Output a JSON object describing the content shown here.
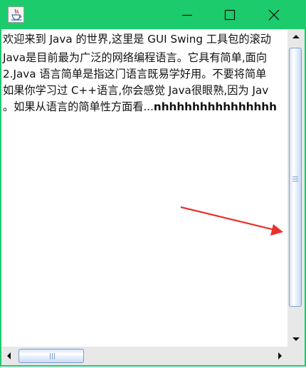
{
  "window": {
    "icon": "java-cup-icon",
    "controls": {
      "minimize": "minimize-icon",
      "maximize": "maximize-icon",
      "close": "close-icon"
    },
    "colors": {
      "frame": "#1ccc6c",
      "text": "#111111",
      "scroll_thumb_border": "#7d9fd2",
      "annotation_arrow": "#e8302c"
    }
  },
  "textarea": {
    "lines": [
      "欢迎来到 Java 的世界,这里是 GUI Swing 工具包的滚动",
      " Java是目前最为广泛的网络编程语言。它具有简单,面向",
      " 2.Java 语言简单是指这门语言既易学好用。不要将简单",
      "如果你学习过 C++语言,你会感觉 Java很眼熟,因为 Jav",
      "。如果从语言的简单性方面看...",
      "nhhhhhhhhhhhhhhh"
    ]
  },
  "scrollbars": {
    "vertical": {
      "up": "arrow-up-icon",
      "down": "arrow-down-icon"
    },
    "horizontal": {
      "left": "arrow-left-icon",
      "right": "arrow-right-icon"
    }
  }
}
